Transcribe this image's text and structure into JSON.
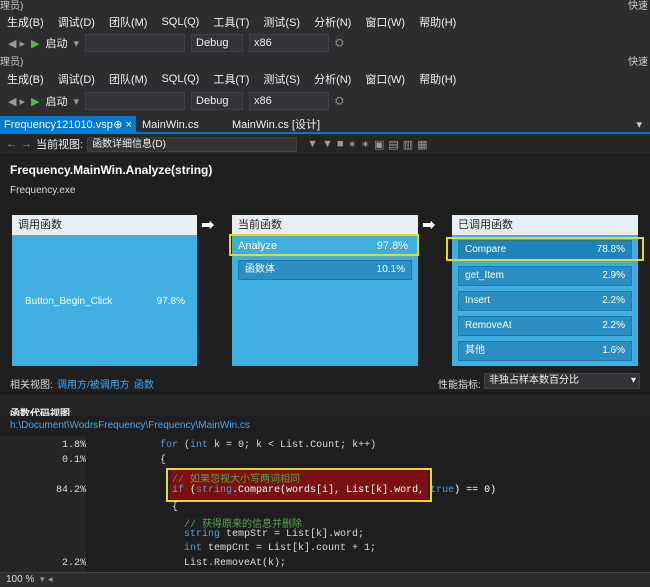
{
  "top_partial": {
    "left_text": "理员)",
    "right_text": "快速"
  },
  "menu": [
    "生成(B)",
    "调试(D)",
    "团队(M)",
    "SQL(Q)",
    "工具(T)",
    "测试(S)",
    "分析(N)",
    "窗口(W)",
    "帮助(H)"
  ],
  "toolbar": {
    "start_label": "启动",
    "config": "Debug",
    "platform": "x86"
  },
  "second_partial": {
    "left_text": "理员)",
    "right_text": "快速"
  },
  "doc_tabs": [
    {
      "label": "Frequency121010.vsp",
      "pin": "⊕ ×",
      "active": true
    },
    {
      "label": "MainWin.cs",
      "active": false
    },
    {
      "label": "MainWin.cs [设计]",
      "active": false
    }
  ],
  "view_nav": {
    "label": "当前视图:",
    "value": "函数详细信息(D)"
  },
  "function_title": "Frequency.MainWin.Analyze(string)",
  "module": "Frequency.exe",
  "callers": {
    "header": "调用函数",
    "rows": [
      {
        "name": "Button_Begin_Click",
        "pct": "97.8%"
      }
    ]
  },
  "current": {
    "header": "当前函数",
    "name": "Analyze",
    "pct": "97.8%",
    "body_label": "函数体",
    "body_pct": "10.1%"
  },
  "callees": {
    "header": "已调用函数",
    "rows": [
      {
        "name": "Compare",
        "pct": "78.8%"
      },
      {
        "name": "get_Item",
        "pct": "2.9%"
      },
      {
        "name": "Insert",
        "pct": "2.2%"
      },
      {
        "name": "RemoveAt",
        "pct": "2.2%"
      },
      {
        "name": "其他",
        "pct": "1.6%"
      }
    ]
  },
  "related": {
    "label": "相关视图:",
    "link1": "调用方/被调用方",
    "link2": "函数"
  },
  "metric": {
    "label": "性能指标:",
    "value": "非独占样本数百分比"
  },
  "code_view": {
    "title": "函数代码视图",
    "path": "h:\\Document\\WodrsFrequency\\Frequency\\MainWin.cs"
  },
  "code_lines": [
    {
      "pct": "1.8%",
      "code": "for (int k = 0; k < List.Count; k++)"
    },
    {
      "pct": "0.1%",
      "code": "{"
    },
    {
      "pct": "",
      "code": "// 如果忽视大小写两词相同"
    },
    {
      "pct": "84.2%",
      "code": "if (string.Compare(words[i], List[k].word, true) == 0)"
    },
    {
      "pct": "",
      "code": "{"
    },
    {
      "pct": "",
      "code": "// 获得原来的信息并删除"
    },
    {
      "pct": "",
      "code": "string tempStr = List[k].word;"
    },
    {
      "pct": "",
      "code": "int tempCnt = List[k].count + 1;"
    },
    {
      "pct": "2.2%",
      "code": "List.RemoveAt(k);"
    }
  ],
  "zoom": "100 %",
  "colors": {
    "accent": "#007acc",
    "highlight": "#e8d81f",
    "tile": "#3faee0"
  }
}
